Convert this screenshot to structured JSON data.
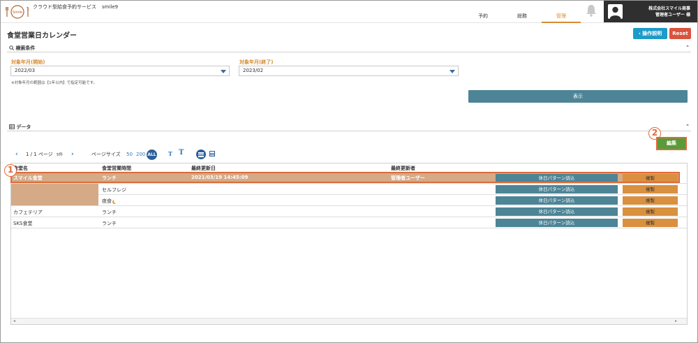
{
  "header": {
    "logo_text": "Smile",
    "service_name": "クラウド型給食予約サービス",
    "tenant": "smile9",
    "nav": [
      {
        "label": "予約"
      },
      {
        "label": "総務"
      },
      {
        "label": "管理"
      }
    ],
    "company": "株式会社スマイル商事",
    "user": "管理者ユーザー 様"
  },
  "page": {
    "title": "食堂営業日カレンダー",
    "help_button": "操作説明",
    "reset_button": "Reset"
  },
  "search": {
    "section_label": "検索条件",
    "start_label": "対象年月(開始)",
    "start_value": "2022/03",
    "end_label": "対象年月(終了)",
    "end_value": "2023/02",
    "note": "※対象年月の範囲は【1年以内】で指定可能です。",
    "show_button": "表示"
  },
  "data_section": {
    "label": "データ",
    "edit_button": "編集",
    "callout_1": "1",
    "callout_2": "2"
  },
  "pager": {
    "page_info": "1 / 1 ページ",
    "count": "5件",
    "page_size_label": "ページサイズ",
    "size_50": "50",
    "size_200": "200",
    "size_all": "ALL",
    "font_small": "T",
    "font_large": "T"
  },
  "table": {
    "columns": [
      "食堂名",
      "食堂営業時間",
      "最終更新日",
      "最終更新者"
    ],
    "pattern_button": "休日パターン読込",
    "copy_button": "複製",
    "rows": [
      {
        "name": "スマイル食堂",
        "time": "ランチ",
        "updated": "2021/03/19 14:45:09",
        "updater": "管理者ユーザー"
      },
      {
        "name": "",
        "time": "セルフレジ",
        "updated": "",
        "updater": ""
      },
      {
        "name": "",
        "time": "夜食",
        "updated": "",
        "updater": ""
      },
      {
        "name": "カフェテリア",
        "time": "ランチ",
        "updated": "",
        "updater": ""
      },
      {
        "name": "SKS食堂",
        "time": "ランチ",
        "updated": "",
        "updater": ""
      }
    ]
  },
  "colors": {
    "accent": "#d88a2f",
    "highlight": "#d4ab86",
    "callout": "#e06a3a",
    "teal_button": "#4d8496",
    "copy_button": "#d9903f"
  }
}
